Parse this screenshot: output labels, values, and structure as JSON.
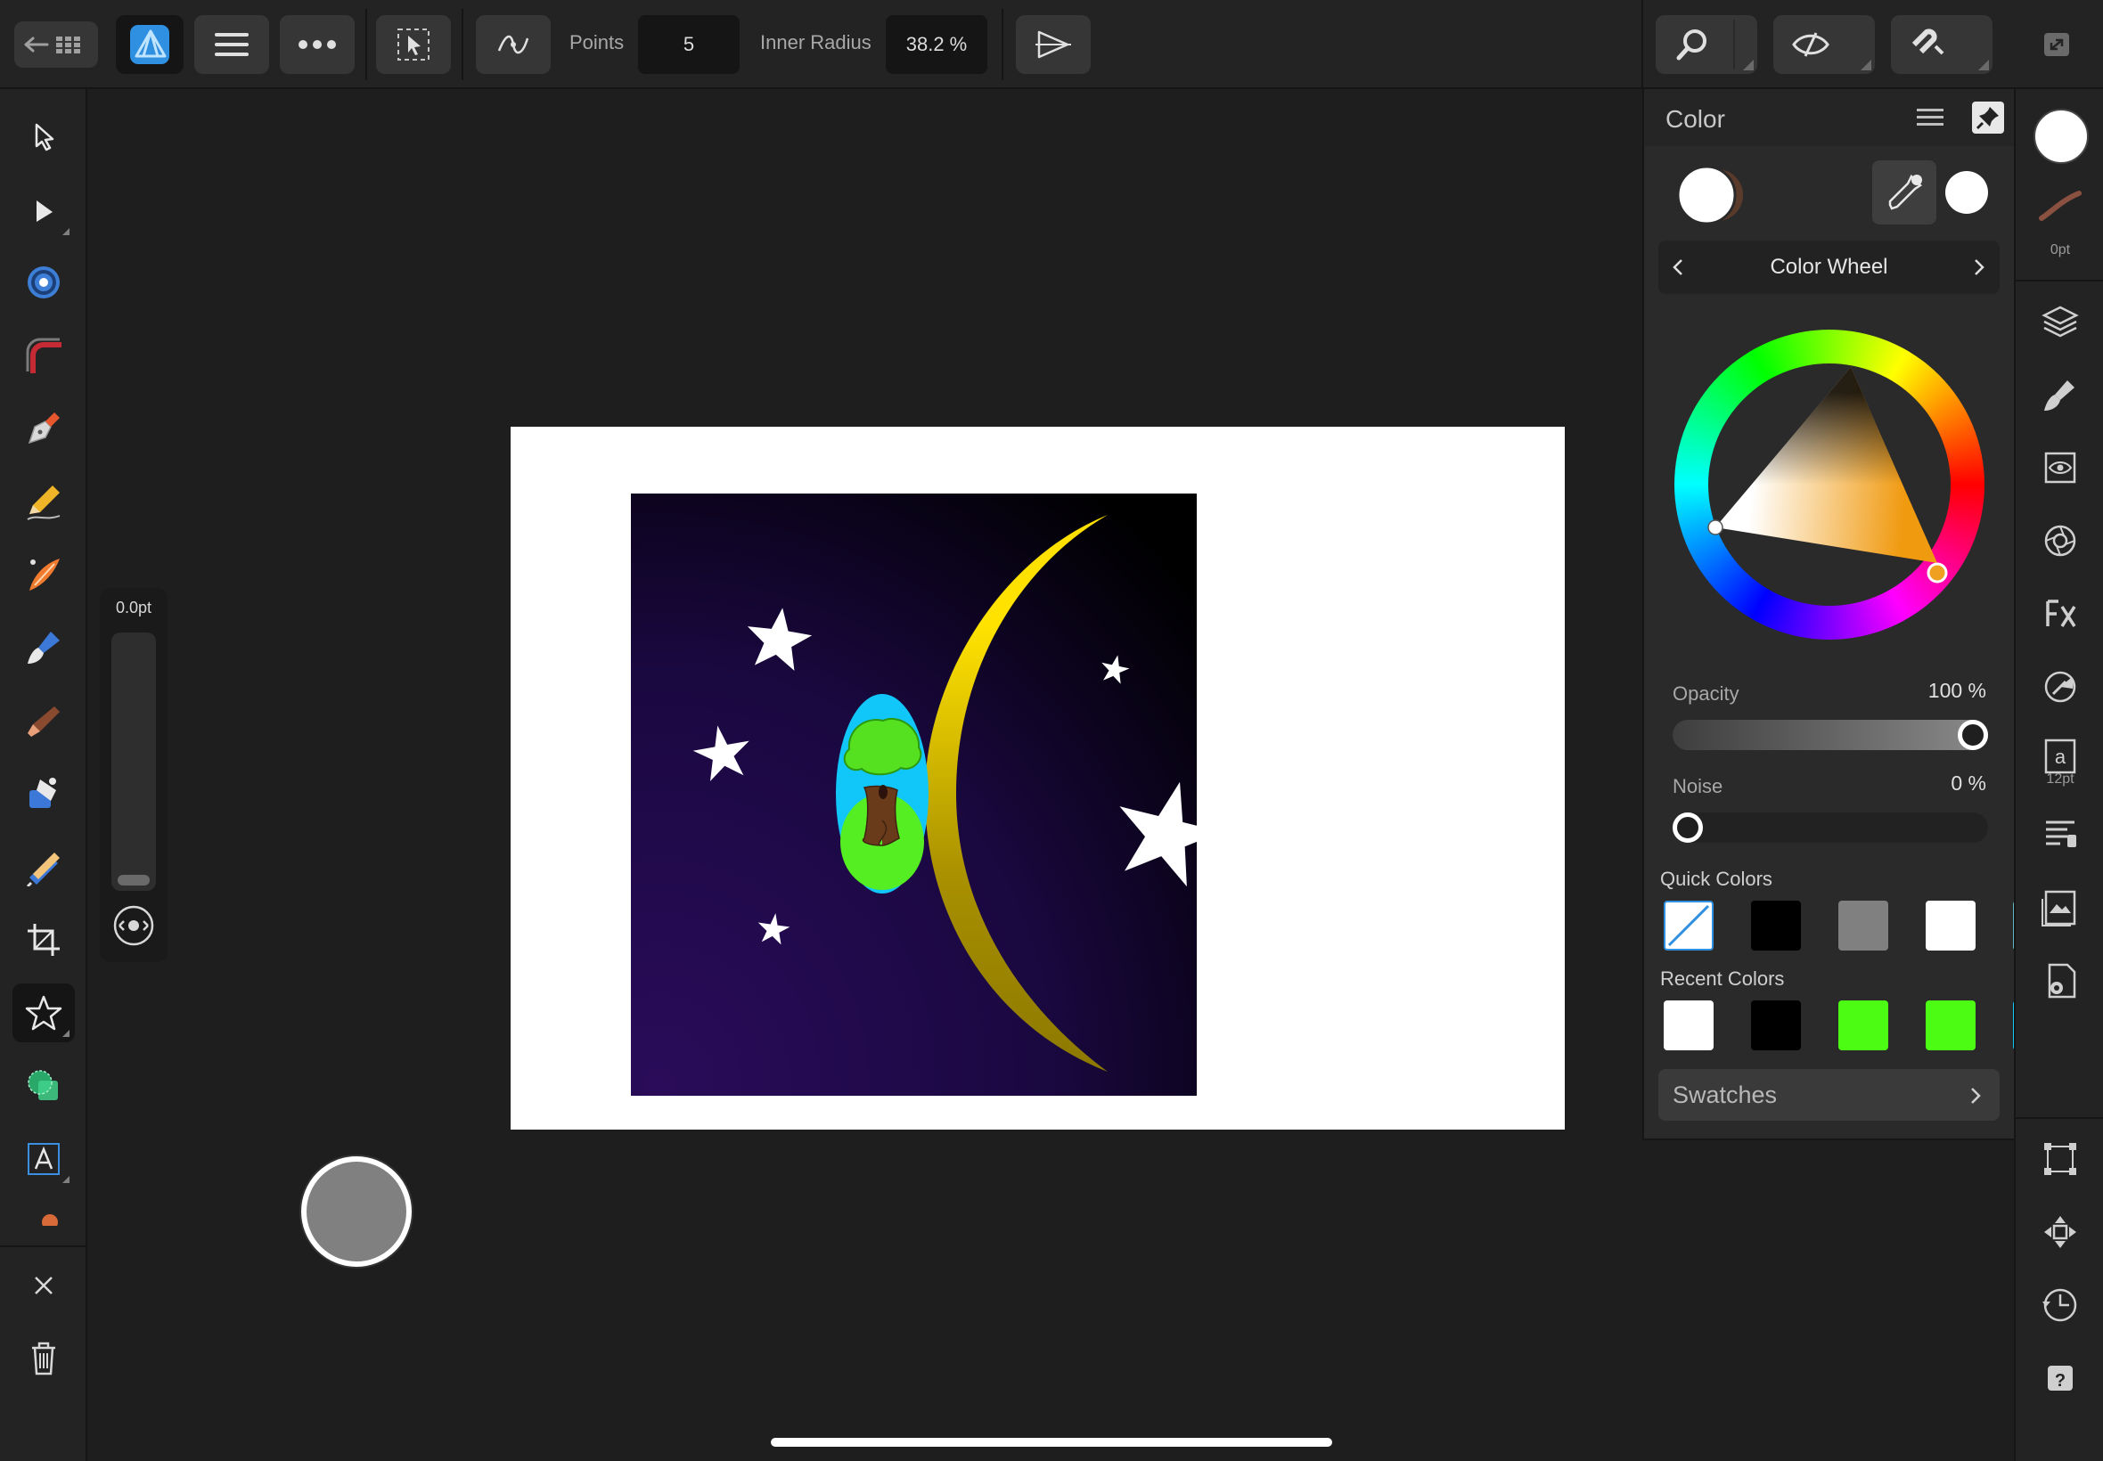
{
  "toolbar": {
    "points_label": "Points",
    "points_value": "5",
    "inner_radius_label": "Inner Radius",
    "inner_radius_value": "38.2 %"
  },
  "stroke_slider": {
    "value": "0.0pt"
  },
  "color_panel": {
    "title": "Color",
    "mode": "Color Wheel",
    "opacity_label": "Opacity",
    "opacity_value": "100 %",
    "opacity_level": 1.0,
    "noise_label": "Noise",
    "noise_value": "0 %",
    "noise_level": 0.0,
    "quick_colors_label": "Quick Colors",
    "quick_colors": [
      "none",
      "#000000",
      "#808080",
      "#ffffff",
      "#62b5c6"
    ],
    "recent_colors_label": "Recent Colors",
    "recent_colors": [
      "#ffffff",
      "#000000",
      "#4cfc12",
      "#4cfc12",
      "#0cc8fa"
    ],
    "swatches_label": "Swatches"
  },
  "right_bar": {
    "stroke_width": "0pt",
    "text_size": "12pt"
  },
  "colors": {
    "accent": "#2f8fe0",
    "moon_yellow": "#ffe000",
    "sky_dark": "#1a0840",
    "tree_green": "#55e020"
  },
  "icons": {
    "left_tools": [
      "move-tool-icon",
      "node-tool-icon",
      "contour-tool-icon",
      "corner-tool-icon",
      "pen-tool-icon",
      "pencil-tool-icon",
      "vector-brush-icon",
      "fill-tool-icon",
      "transparency-tool-icon",
      "place-image-icon",
      "vector-crop-icon",
      "shape-tool-icon",
      "star-shape-icon",
      "boolean-icon",
      "artistic-text-icon"
    ],
    "right_studios": [
      "layers-icon",
      "brushes-icon",
      "appearance-icon",
      "effects-icon",
      "fx-icon",
      "styles-icon",
      "text-styles-icon",
      "paragraph-icon",
      "stock-icon",
      "settings-icon",
      "transform-icon",
      "navigator-icon",
      "history-icon",
      "help-icon"
    ]
  }
}
